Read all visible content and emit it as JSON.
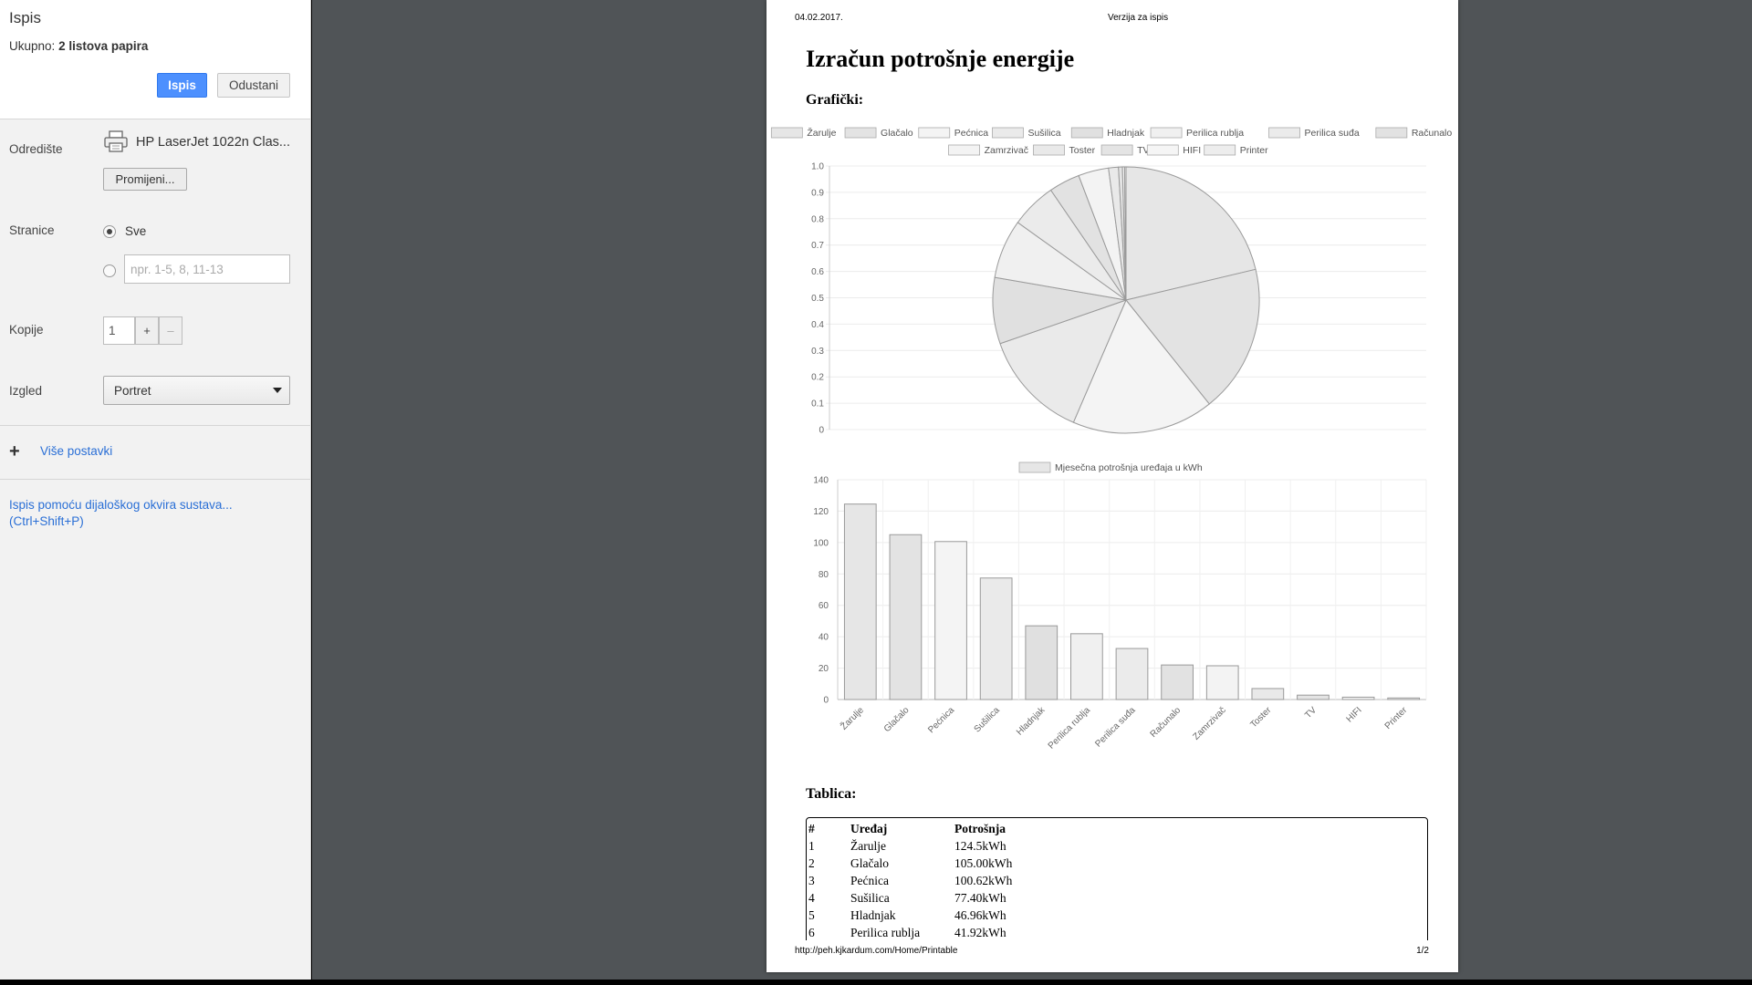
{
  "dialog": {
    "title": "Ispis",
    "total_prefix": "Ukupno:",
    "total_value": "2 listova papira",
    "print_button": "Ispis",
    "cancel_button": "Odustani",
    "destination_label": "Odredište",
    "destination_name": "HP LaserJet 1022n Clas...",
    "change_button": "Promijeni...",
    "pages_label": "Stranice",
    "pages_all": "Sve",
    "pages_placeholder": "npr. 1-5, 8, 11-13",
    "copies_label": "Kopije",
    "copies_value": "1",
    "copies_plus": "+",
    "copies_minus": "–",
    "layout_label": "Izgled",
    "layout_value": "Portret",
    "more_settings": "Više postavki",
    "system_dialog_link": "Ispis pomoću dijaloškog okvira sustava...",
    "system_dialog_shortcut": "(Ctrl+Shift+P)",
    "icons": [
      "printer-icon",
      "plus-icon",
      "chevron-down-icon"
    ]
  },
  "page": {
    "date": "04.02.2017.",
    "version": "Verzija za ispis",
    "title": "Izračun potrošnje energije",
    "graphics_heading": "Grafički:",
    "table_heading": "Tablica:",
    "footer_url": "http://peh.kjkardum.com/Home/Printable",
    "page_number": "1/2"
  },
  "chart_data": [
    {
      "type": "pie",
      "legend_position": "top",
      "labels": [
        "Žarulje",
        "Glačalo",
        "Pećnica",
        "Sušilica",
        "Hladnjak",
        "Perilica rublja",
        "Perilica suđa",
        "Računalo",
        "Zamrzivač",
        "Toster",
        "TV",
        "HIFI",
        "Printer"
      ],
      "values": [
        124.5,
        105.0,
        100.62,
        77.4,
        46.96,
        41.92,
        32.5,
        22.0,
        21.5,
        7.0,
        2.8,
        1.5,
        1.0
      ],
      "colors": [
        "#e6e6e6",
        "#e3e3e3",
        "#f4f4f4",
        "#eaeaea",
        "#e0e0e0",
        "#f0f0f0",
        "#ebebeb",
        "#e2e2e2",
        "#f3f3f3",
        "#e9e9e9",
        "#e4e4e4",
        "#f5f5f5",
        "#ededed"
      ],
      "ylim": [
        0,
        1.0
      ],
      "yticks": [
        "1.0",
        "0.9",
        "0.8",
        "0.7",
        "0.6",
        "0.5",
        "0.4",
        "0.3",
        "0.2",
        "0.1",
        "0"
      ],
      "grid": true
    },
    {
      "type": "bar",
      "series": [
        {
          "name": "Mjesečna potrošnja uređaja u kWh",
          "values": [
            124.5,
            105.0,
            100.62,
            77.4,
            46.96,
            41.92,
            32.5,
            22.0,
            21.5,
            7.0,
            2.8,
            1.5,
            1.0
          ]
        }
      ],
      "categories": [
        "Žarulje",
        "Glačalo",
        "Pećnica",
        "Sušilica",
        "Hladnjak",
        "Perilica rublja",
        "Perilica suđa",
        "Računalo",
        "Zamrzivač",
        "Toster",
        "TV",
        "HIFI",
        "Printer"
      ],
      "ylim": [
        0,
        140
      ],
      "yticks": [
        "140",
        "120",
        "100",
        "80",
        "60",
        "40",
        "20",
        "0"
      ],
      "grid": true,
      "legend_position": "top"
    }
  ],
  "table": {
    "headers": [
      "#",
      "Uređaj",
      "Potrošnja"
    ],
    "rows": [
      [
        "1",
        "Žarulje",
        "124.5kWh"
      ],
      [
        "2",
        "Glačalo",
        "105.00kWh"
      ],
      [
        "3",
        "Pećnica",
        "100.62kWh"
      ],
      [
        "4",
        "Sušilica",
        "77.40kWh"
      ],
      [
        "5",
        "Hladnjak",
        "46.96kWh"
      ],
      [
        "6",
        "Perilica rublja",
        "41.92kWh"
      ]
    ]
  }
}
